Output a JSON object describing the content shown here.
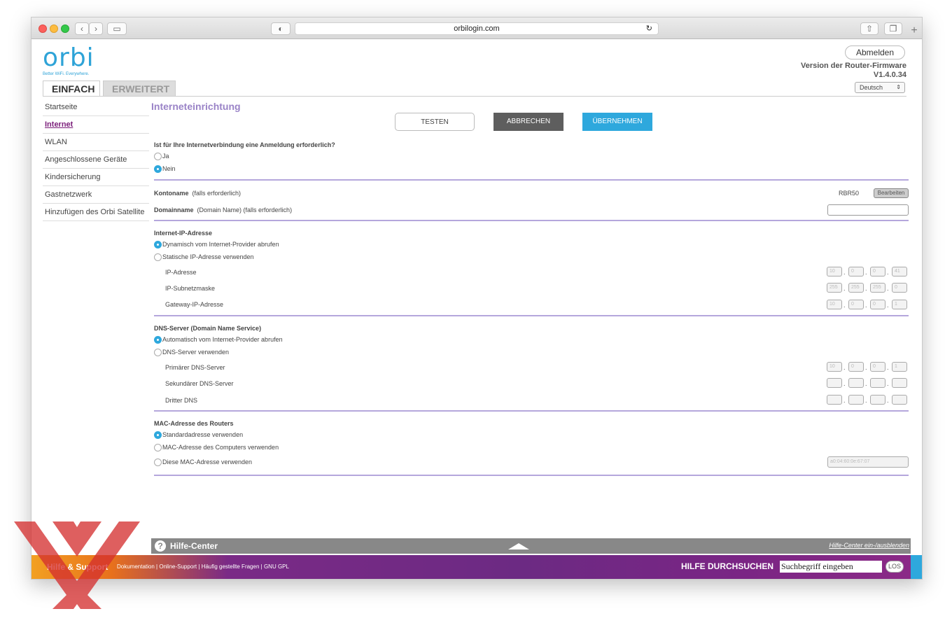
{
  "browser": {
    "url": "orbilogin.com"
  },
  "brand": {
    "logo": "orbi",
    "tagline": "Better WiFi. Everywhere."
  },
  "tabs": {
    "basic": "EINFACH",
    "advanced": "ERWEITERT"
  },
  "header": {
    "logout": "Abmelden",
    "firmware_label": "Version der Router-Firmware",
    "firmware_version": "V1.4.0.34",
    "language": "Deutsch"
  },
  "sidebar": {
    "items": [
      {
        "label": "Startseite"
      },
      {
        "label": "Internet"
      },
      {
        "label": "WLAN"
      },
      {
        "label": "Angeschlossene Geräte"
      },
      {
        "label": "Kindersicherung"
      },
      {
        "label": "Gastnetzwerk"
      },
      {
        "label": "Hinzufügen des Orbi Satellite"
      }
    ],
    "active_index": 1
  },
  "main": {
    "title": "Interneteinrichtung",
    "buttons": {
      "test": "TESTEN",
      "cancel": "ABBRECHEN",
      "apply": "ÜBERNEHMEN"
    },
    "login": {
      "question": "Ist für Ihre Internetverbindung eine Anmeldung erforderlich?",
      "yes": "Ja",
      "no": "Nein",
      "selected": "no"
    },
    "account": {
      "name_label": "Kontoname",
      "name_hint": "(falls erforderlich)",
      "name_value": "RBR50",
      "edit": "Bearbeiten",
      "domain_label": "Domainname",
      "domain_hint": "(Domain Name) (falls erforderlich)",
      "domain_value": ""
    },
    "ip": {
      "heading": "Internet-IP-Adresse",
      "dynamic": "Dynamisch vom Internet-Provider abrufen",
      "static": "Statische IP-Adresse verwenden",
      "selected": "dynamic",
      "rows": [
        {
          "label": "IP-Adresse",
          "octets": [
            "10",
            "0",
            "0",
            "41"
          ]
        },
        {
          "label": "IP-Subnetzmaske",
          "octets": [
            "255",
            "255",
            "255",
            "0"
          ]
        },
        {
          "label": "Gateway-IP-Adresse",
          "octets": [
            "10",
            "0",
            "0",
            "1"
          ]
        }
      ]
    },
    "dns": {
      "heading": "DNS-Server (Domain Name Service)",
      "auto": "Automatisch vom Internet-Provider abrufen",
      "manual": "DNS-Server verwenden",
      "selected": "auto",
      "rows": [
        {
          "label": "Primärer DNS-Server",
          "octets": [
            "10",
            "0",
            "0",
            "1"
          ]
        },
        {
          "label": "Sekundärer DNS-Server",
          "octets": [
            "",
            "",
            "",
            ""
          ]
        },
        {
          "label": "Dritter DNS",
          "octets": [
            "",
            "",
            "",
            ""
          ]
        }
      ]
    },
    "mac": {
      "heading": "MAC-Adresse des Routers",
      "default": "Standardadresse verwenden",
      "computer": "MAC-Adresse des Computers verwenden",
      "custom": "Diese MAC-Adresse verwenden",
      "selected": "default",
      "custom_value": "a0:04:60:0e:67:07"
    }
  },
  "help": {
    "title": "Hilfe-Center",
    "toggle": "Hilfe-Center ein-/ausblenden"
  },
  "footer": {
    "title": "Hilfe & Support",
    "links": [
      "Dokumentation",
      "Online-Support",
      "Häufig gestellte Fragen",
      "GNU GPL"
    ],
    "search_label": "HILFE DURCHSUCHEN",
    "search_value": "Suchbegriff eingeben",
    "search_go": "LOS"
  },
  "colors": {
    "accent": "#2ea8dd",
    "purple": "#7b1e7a",
    "section_rule": "#b5a7dc",
    "watermark": "#d42f2f"
  }
}
